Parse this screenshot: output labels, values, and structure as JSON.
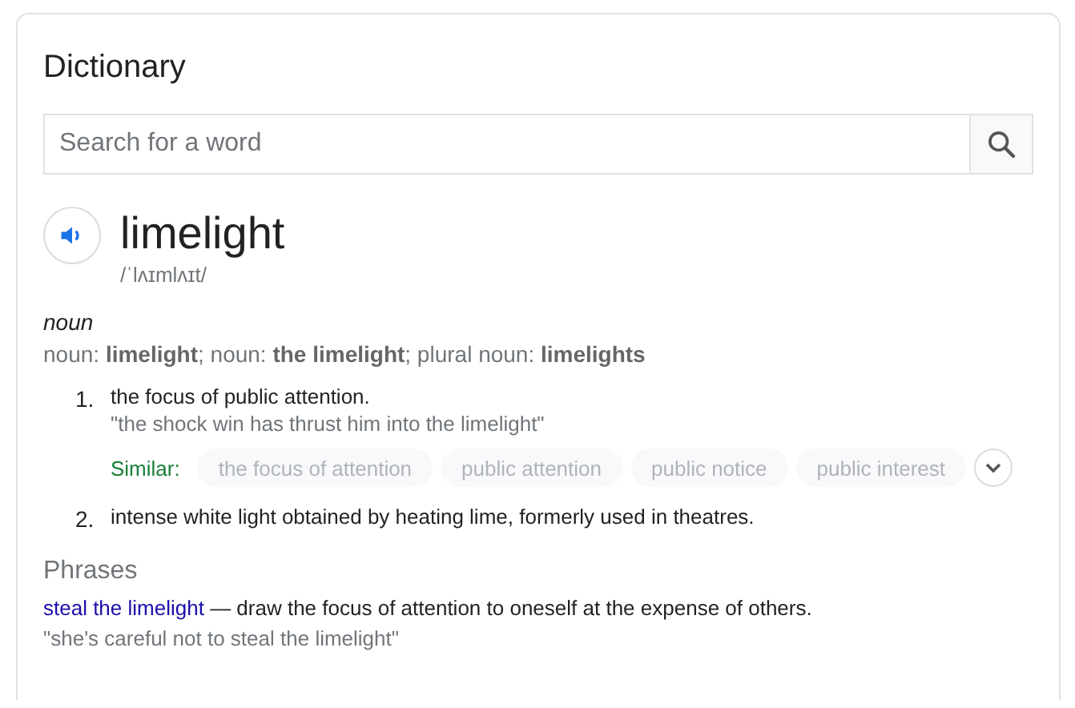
{
  "title": "Dictionary",
  "search": {
    "placeholder": "Search for a word"
  },
  "word": "limelight",
  "pronunciation": "/ˈlʌɪmlʌɪt/",
  "part_of_speech": "noun",
  "forms": "noun: **limelight**; noun: **the limelight**; plural noun: **limelights**",
  "senses": [
    {
      "number": "1.",
      "definition": "the focus of public attention.",
      "example": "\"the shock win has thrust him into the limelight\"",
      "similar_label": "Similar:",
      "similar": [
        "the focus of attention",
        "public attention",
        "public notice",
        "public interest"
      ],
      "expanded": false
    },
    {
      "number": "2.",
      "definition": "intense white light obtained by heating lime, formerly used in theatres."
    }
  ],
  "phrases": {
    "heading": "Phrases",
    "items": [
      {
        "phrase": "steal the limelight",
        "definition": " — draw the focus of attention to oneself at the expense of others.",
        "example": "\"she's careful not to steal the limelight\""
      }
    ]
  }
}
